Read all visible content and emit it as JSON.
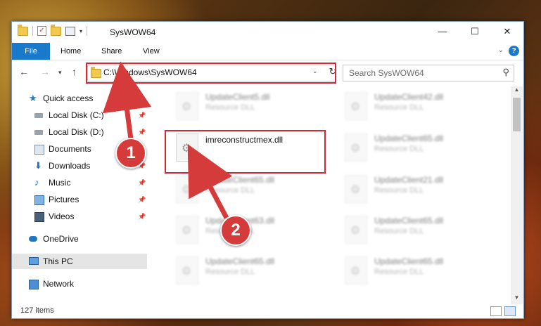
{
  "window": {
    "title": "SysWOW64"
  },
  "ribbon": {
    "tabs": [
      "File",
      "Home",
      "Share",
      "View"
    ]
  },
  "address": {
    "path": "C:\\Windows\\SysWOW64"
  },
  "search": {
    "placeholder": "Search SysWOW64"
  },
  "sidebar": {
    "items": [
      {
        "label": "Quick access",
        "icon": "star-icon"
      },
      {
        "label": "Local Disk (C:)",
        "icon": "disk-icon",
        "pinned": true
      },
      {
        "label": "Local Disk (D:)",
        "icon": "disk-icon",
        "pinned": true
      },
      {
        "label": "Documents",
        "icon": "documents-icon",
        "pinned": true
      },
      {
        "label": "Downloads",
        "icon": "download-icon",
        "pinned": true
      },
      {
        "label": "Music",
        "icon": "music-icon",
        "pinned": true
      },
      {
        "label": "Pictures",
        "icon": "pictures-icon",
        "pinned": true
      },
      {
        "label": "Videos",
        "icon": "videos-icon",
        "pinned": true
      },
      {
        "label": "OneDrive",
        "icon": "cloud-icon"
      },
      {
        "label": "This PC",
        "icon": "computer-icon",
        "selected": true
      },
      {
        "label": "Network",
        "icon": "network-icon"
      }
    ]
  },
  "files": [
    {
      "name": "UpdateClient5.dll",
      "type": "Resource DLL"
    },
    {
      "name": "UpdateClient42.dll",
      "type": "Resource DLL"
    },
    {
      "name": "imreconstructmex.dll",
      "type": ""
    },
    {
      "name": "UpdateClient65.dll",
      "type": "Resource DLL"
    },
    {
      "name": "UpdateClient65.dll",
      "type": "Resource DLL"
    },
    {
      "name": "UpdateClient21.dll",
      "type": "Resource DLL"
    },
    {
      "name": "UpdateClient63.dll",
      "type": "Resource DLL"
    },
    {
      "name": "UpdateClient65.dll",
      "type": "Resource DLL"
    },
    {
      "name": "UpdateClient65.dll",
      "type": "Resource DLL"
    },
    {
      "name": "UpdateClient65.dll",
      "type": "Resource DLL"
    }
  ],
  "status": {
    "item_count": "127 items"
  },
  "annotations": {
    "marker1": "1",
    "marker2": "2",
    "highlight_color": "#d0293a"
  }
}
